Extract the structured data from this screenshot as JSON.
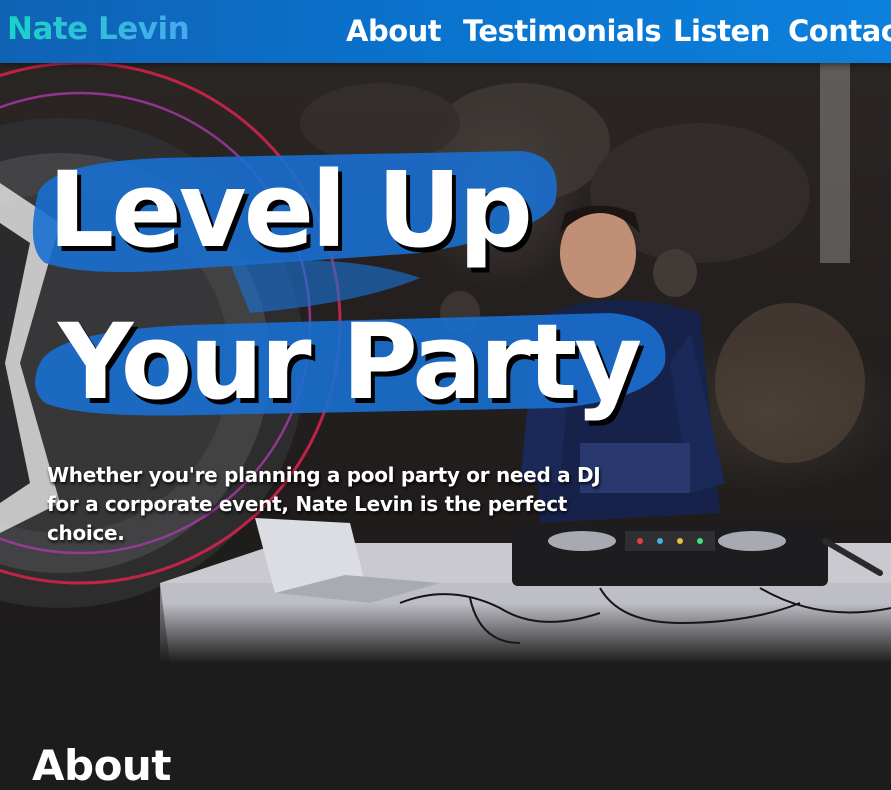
{
  "navbar": {
    "brand": "Nate Levin",
    "links": [
      "About",
      "Testimonials",
      "Listen",
      "Contact"
    ]
  },
  "hero": {
    "headline_line1": "Level Up",
    "headline_line2": "Your Party",
    "subtext": "Whether you're planning a pool party or need a DJ for a corporate event, Nate Levin is the perfect choice."
  },
  "about": {
    "title": "About"
  },
  "colors": {
    "navbar": "#0a72cc",
    "brand_gradient_start": "#19d3c6",
    "brand_gradient_end": "#49a8f0",
    "brush": "#1a6fd0",
    "ring": "#d0234a"
  }
}
